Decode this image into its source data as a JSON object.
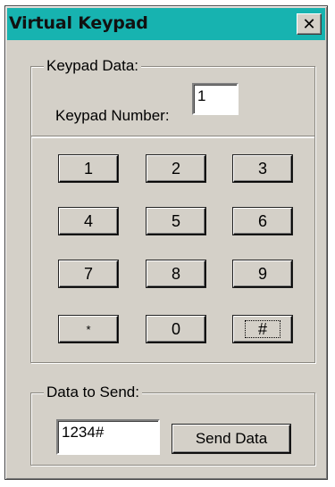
{
  "window": {
    "title": "Virtual Keypad",
    "close_symbol": "✕"
  },
  "keypad_data": {
    "legend": "Keypad Data:",
    "number_label": "Keypad Number:",
    "number_value": "1"
  },
  "keys": [
    "1",
    "2",
    "3",
    "4",
    "5",
    "6",
    "7",
    "8",
    "9",
    "*",
    "0",
    "#"
  ],
  "focused_key": "#",
  "send": {
    "legend": "Data to Send:",
    "value": "1234#",
    "button_label": "Send Data"
  }
}
